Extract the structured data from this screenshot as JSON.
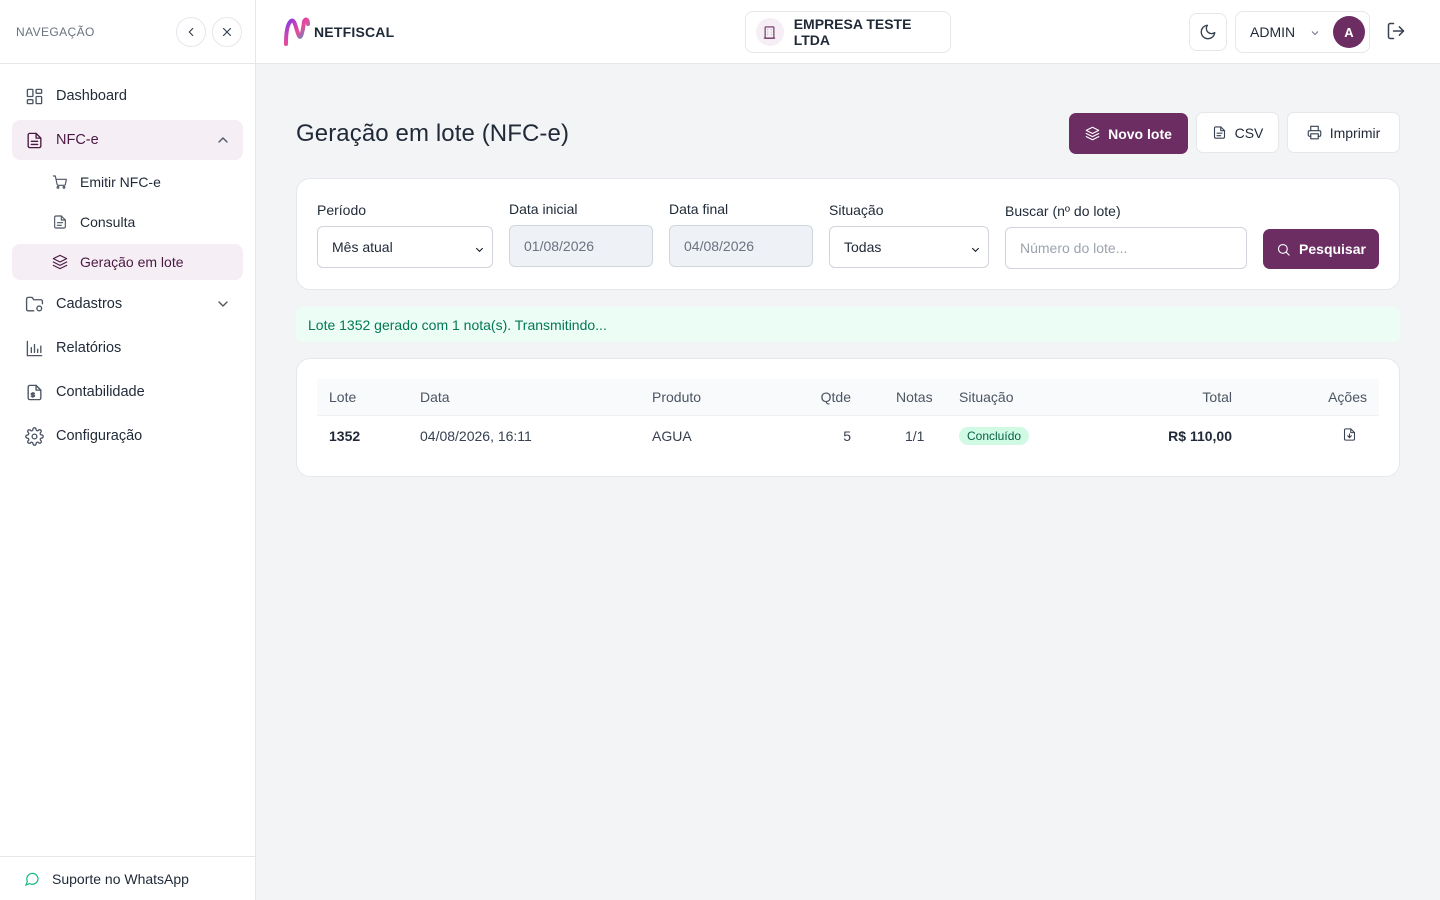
{
  "sidebar": {
    "title": "NAVEGAÇÃO",
    "items": [
      {
        "label": "Dashboard",
        "icon": "dashboard-icon"
      },
      {
        "label": "NFC-e",
        "icon": "file-text-icon",
        "expanded": true,
        "children": [
          {
            "label": "Emitir NFC-e",
            "icon": "cart-icon"
          },
          {
            "label": "Consulta",
            "icon": "document-icon"
          },
          {
            "label": "Geração em lote",
            "icon": "layers-icon",
            "active": true
          }
        ]
      },
      {
        "label": "Cadastros",
        "icon": "folder-settings-icon"
      },
      {
        "label": "Relatórios",
        "icon": "bar-chart-icon"
      },
      {
        "label": "Contabilidade",
        "icon": "file-invoice-icon"
      },
      {
        "label": "Configuração",
        "icon": "gear-icon"
      }
    ],
    "footer": "Suporte no WhatsApp"
  },
  "topbar": {
    "logo_text": "NETFISCAL",
    "company": "EMPRESA TESTE LTDA",
    "user": "ADMIN",
    "avatar_initial": "A"
  },
  "page": {
    "title": "Geração em lote (NFC-e)",
    "actions": {
      "new": "Novo lote",
      "csv": "CSV",
      "print": "Imprimir"
    }
  },
  "filters": {
    "period_label": "Período",
    "period_value": "Mês atual",
    "start_label": "Data inicial",
    "start_value": "01/08/2026",
    "end_label": "Data final",
    "end_value": "04/08/2026",
    "status_label": "Situação",
    "status_value": "Todas",
    "search_label": "Buscar (nº do lote)",
    "search_placeholder": "Número do lote...",
    "search_button": "Pesquisar"
  },
  "alert": "Lote 1352 gerado com 1 nota(s). Transmitindo...",
  "table": {
    "headers": [
      "Lote",
      "Data",
      "Produto",
      "Qtde",
      "Notas",
      "Situação",
      "Total",
      "Ações"
    ],
    "rows": [
      {
        "lote": "1352",
        "data": "04/08/2026, 16:11",
        "produto": "AGUA",
        "qtde": "5",
        "notas": "1/1",
        "situacao": "Concluído",
        "total": "R$ 110,00"
      }
    ]
  },
  "colors": {
    "brand": "#6b2d62",
    "success_bg": "#ecfdf5",
    "success_text": "#047857"
  }
}
